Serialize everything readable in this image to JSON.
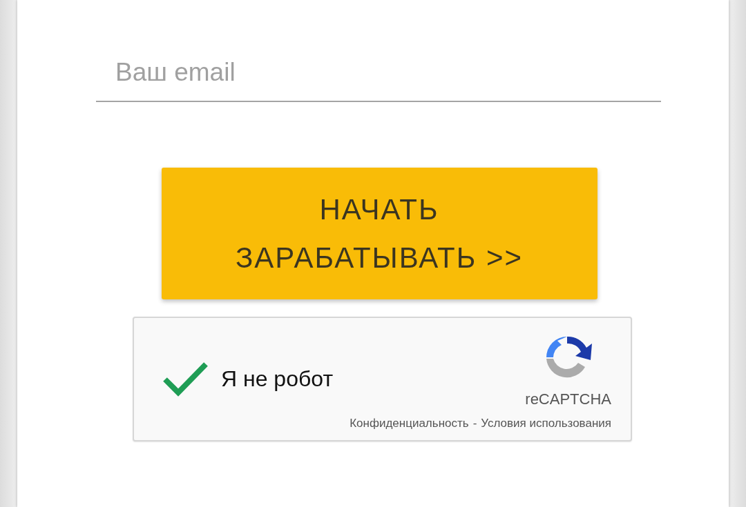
{
  "email_field": {
    "placeholder": "Ваш email"
  },
  "submit_button": {
    "label": "НАЧАТЬ ЗАРАБАТЫВАТЬ >>"
  },
  "captcha": {
    "checked": true,
    "label": "Я не робот",
    "brand": "reCAPTCHA",
    "links": [
      {
        "label": "Конфиденциальность"
      },
      {
        "label": "Условия использования"
      }
    ],
    "separator": "-"
  }
}
